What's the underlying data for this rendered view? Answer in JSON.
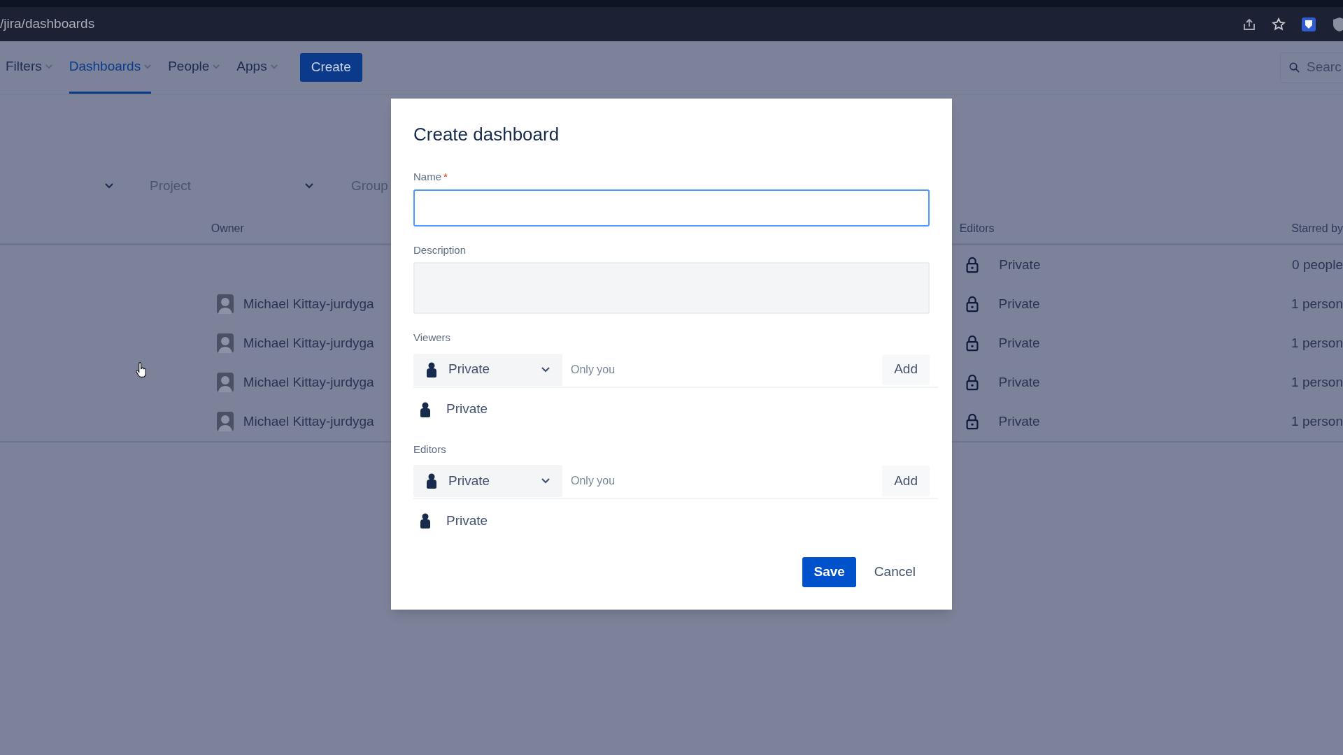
{
  "browser": {
    "url": "/jira/dashboards"
  },
  "nav": {
    "items": [
      {
        "label": "Filters",
        "selected": false
      },
      {
        "label": "Dashboards",
        "selected": true
      },
      {
        "label": "People",
        "selected": false
      },
      {
        "label": "Apps",
        "selected": false
      }
    ],
    "create_button": "Create",
    "search": {
      "placeholder": "Searc"
    }
  },
  "filters": [
    {
      "label": "Project"
    },
    {
      "label": "Group"
    }
  ],
  "table": {
    "columns": [
      "Owner",
      "Editors",
      "Starred by"
    ],
    "rows": [
      {
        "editors": "Private",
        "starred_by": "0 people"
      },
      {
        "owner": "Michael Kittay-jurdyga",
        "editors": "Private",
        "starred_by": "1 person"
      },
      {
        "owner": "Michael Kittay-jurdyga",
        "editors": "Private",
        "starred_by": "1 person"
      },
      {
        "owner": "Michael Kittay-jurdyga",
        "editors": "Private",
        "starred_by": "1 person"
      },
      {
        "owner": "Michael Kittay-jurdyga",
        "editors": "Private",
        "starred_by": "1 person"
      }
    ]
  },
  "dialog": {
    "title": "Create dashboard",
    "name_field": {
      "label": "Name",
      "required_mark": "*",
      "focused": true
    },
    "description_field": {
      "label": "Description"
    },
    "sharing": [
      {
        "label": "Viewers",
        "select": "Private",
        "placeholder": "Only you",
        "add_button": "Add",
        "entries": [
          "Private"
        ]
      },
      {
        "label": "Editors",
        "select": "Private",
        "placeholder": "Only you",
        "add_button": "Add",
        "entries": [
          "Private"
        ]
      }
    ],
    "save_button": "Save",
    "cancel_button": "Cancel"
  }
}
